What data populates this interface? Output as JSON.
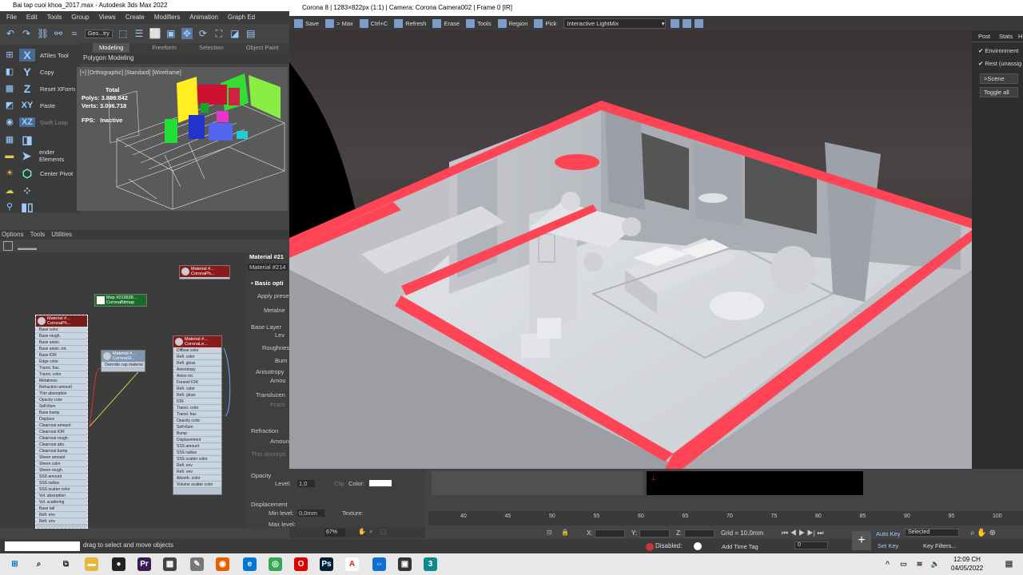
{
  "max": {
    "title": "Bai tap cuoi khoa_2017.max - Autodesk 3ds Max 2022",
    "menu": [
      "File",
      "Edit",
      "Tools",
      "Group",
      "Views",
      "Create",
      "Modifiers",
      "Animation",
      "Graph Ed"
    ],
    "selection_filter": "Geo...try",
    "ribbon_tabs": [
      "Modeling",
      "Freeform",
      "Selection",
      "Object Paint"
    ],
    "ribbon_panel": "Polygon Modeling",
    "left_tools": [
      {
        "icon": "X",
        "label": "ATiles Tool"
      },
      {
        "icon": "Y",
        "label": "Copy"
      },
      {
        "icon": "Z",
        "label": "Reset XForm"
      },
      {
        "icon": "XY",
        "label": "Paste"
      },
      {
        "icon": "XZ",
        "label": "Swift Loop"
      },
      {
        "icon": "",
        "label": ""
      },
      {
        "icon": "",
        "label": "ender Elements"
      },
      {
        "icon": "",
        "label": "Center Pivot"
      }
    ],
    "viewport_label": "[+] [Orthographic] [Standard] [Wireframe]",
    "stats": {
      "total": "Total",
      "polys_label": "Polys:",
      "polys": "3.886.842",
      "verts_label": "Verts:",
      "verts": "3.096.718",
      "fps_label": "FPS:",
      "fps": "Inactive"
    },
    "command_tabs": [
      "Options",
      "Tools",
      "Utilities"
    ],
    "material_panel": {
      "header": "Material #21",
      "subheader": "Material #214",
      "section": "Basic opti",
      "apply_preset": "Apply prese",
      "metalness": "Metalne",
      "base_layer": "Base Layer",
      "level": "Lev",
      "roughness": "Roughnes",
      "bump": "Bum",
      "anisotropy": "Anisotropy",
      "amount": "Amou",
      "translucency": "Translucen",
      "fraction": "Fracti",
      "refraction": "Refraction",
      "ref_amount": "Amoun",
      "thin_absorption": "Thin absorpti",
      "opacity": "Opacity",
      "opacity_level_label": "Level:",
      "opacity_level": "1,0",
      "clip": "Clip",
      "color": "Color:",
      "displacement": "Displacement",
      "min_level_label": "Min level:",
      "min_level": "0,0mm",
      "texture": "Texture:",
      "max_level": "Max level:"
    },
    "nodes": {
      "map_head": "Map #213638...",
      "map_sub": "CoronaBitmap",
      "mat_left_head": "Material #...",
      "mat_left_sub": "CoronaPh...",
      "mat_mid_head": "Material #...",
      "mat_mid_sub": "CoronaSl...",
      "mat_mid_row": "Override cap material",
      "mat_right_head": "Material #...",
      "mat_right_sub": "CoronaLe...",
      "mat_top_head": "Material #...",
      "mat_top_sub": "CoronaPh...",
      "left_rows": [
        "Base color",
        "Base rough.",
        "Base aniso.",
        "Base aniso. rot.",
        "Base IOR",
        "Edge color",
        "Transl. frac.",
        "Transl. color",
        "Metalness",
        "Refraction amount",
        "Thin absorption",
        "Opacity color",
        "Self-illum",
        "Base bump",
        "Displace",
        "Clearcoat amount",
        "Clearcoat IOR",
        "Clearcoat rough.",
        "Clearcoat abs.",
        "Clearcoat bump",
        "Sheen amount",
        "Sheen color",
        "Sheen rough.",
        "SSS amount",
        "SSS radius",
        "SSS scatter color",
        "Vol. absorption",
        "Vol. scattering",
        "Base tail",
        "Refl. env",
        "Refr. env"
      ],
      "right_rows": [
        "Diffuse color",
        "Refl. color",
        "Refl. gloss",
        "Anisotropy",
        "Aniso rot.",
        "Fresnel IOR",
        "Refr. color",
        "Refr. gloss",
        "IOR",
        "Transl. color",
        "Transl. frac",
        "Opacity color",
        "Self-illum",
        "Bump",
        "Displacement",
        "SSS amount",
        "SSS radius",
        "SSS scatter color",
        "Refl. env",
        "Refr. env",
        "Absorb. color",
        "Volume scatter color"
      ]
    },
    "zoom": "67%",
    "prompt": "drag to select and move objects",
    "coords": {
      "x_label": "X:",
      "y_label": "Y:",
      "z_label": "Z:",
      "grid": "Grid = 10,0mm"
    },
    "disabled": "Disabled:",
    "add_time_tag": "Add Time Tag",
    "auto_key": "Auto Key",
    "set_key": "Set Key",
    "selected": "Selected",
    "key_filters": "Key Filters...",
    "frame": "0",
    "timeline_ticks": [
      "40",
      "45",
      "50",
      "55",
      "60",
      "65",
      "70",
      "75",
      "80",
      "85",
      "90",
      "95",
      "100"
    ]
  },
  "vfb": {
    "title": "Corona 8 | 1283×822px (1:1) | Camera: Corona Camera002 | Frame 0 [IR]",
    "toolbar": [
      "Save",
      "> Max",
      "Ctrl+C",
      "Refresh",
      "Erase",
      "Tools",
      "Region",
      "Pick"
    ],
    "lightmix": "Interactive LightMix",
    "side_tabs": [
      "Post",
      "Stats",
      "H"
    ],
    "environment": "Environment",
    "rest": "Rest (unassig",
    "scene_btn": ">Scene",
    "toggle_all": "Toggle all"
  },
  "clock": {
    "time": "12:09 CH",
    "date": "04/05/2022"
  },
  "colors": {
    "accent_red": "#ff4555",
    "render_gray": "#d8dade",
    "vfb_bg": "#3a3a3a"
  }
}
